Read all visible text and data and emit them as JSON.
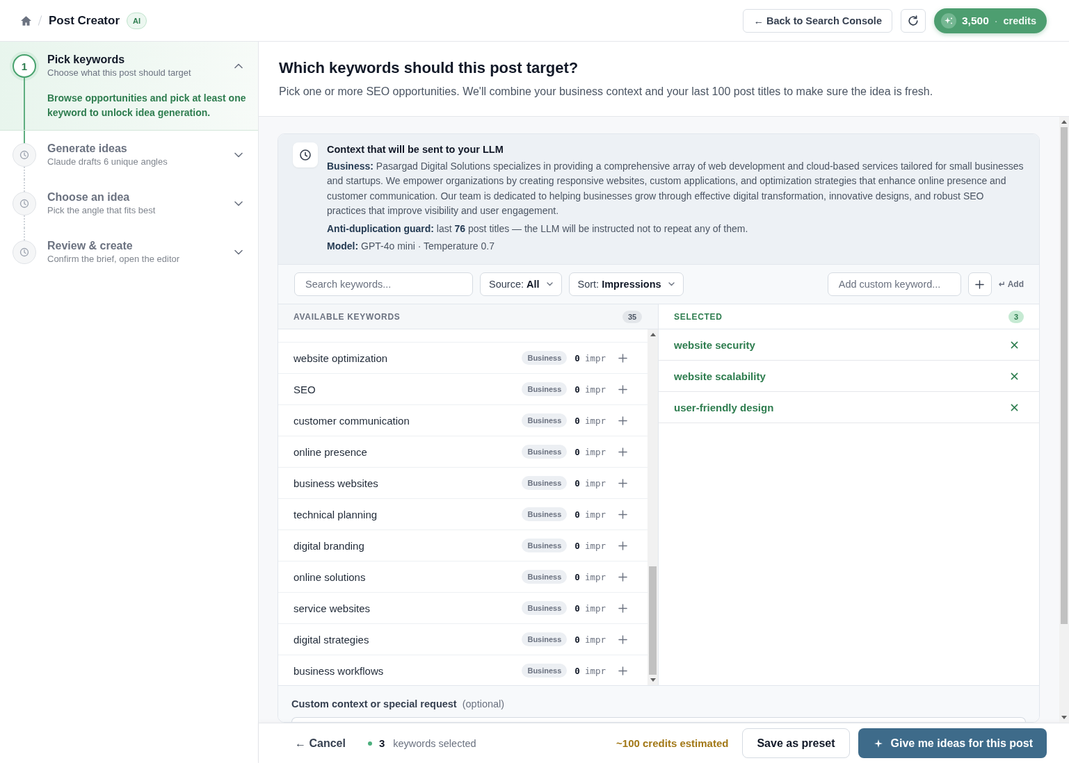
{
  "header": {
    "title": "Post Creator",
    "badge": "AI",
    "back_button": "← Back to Search Console",
    "credits": {
      "amount": "3,500",
      "separator": "·",
      "unit": "credits"
    }
  },
  "steps": [
    {
      "number": "1",
      "title": "Pick keywords",
      "subtitle": "Choose what this post should target",
      "description": "Browse opportunities and pick at least one keyword to unlock idea generation.",
      "selected": true,
      "expanded": true
    },
    {
      "title": "Generate ideas",
      "subtitle": "Claude drafts 6 unique angles",
      "selected": false,
      "expanded": false
    },
    {
      "title": "Choose an idea",
      "subtitle": "Pick the angle that fits best",
      "selected": false,
      "expanded": false
    },
    {
      "title": "Review & create",
      "subtitle": "Confirm the brief, open the editor",
      "selected": false,
      "expanded": false
    }
  ],
  "page": {
    "title": "Which keywords should this post target?",
    "subtitle": "Pick one or more SEO opportunities. We'll combine your business context and your last 100 post titles to make sure the idea is fresh."
  },
  "context": {
    "title": "Context that will be sent to your LLM",
    "lines": [
      "**Business:** Pasargad Digital Solutions specializes in providing a comprehensive array of web development and cloud-based services tailored for small businesses and startups. We empower organizations by creating responsive websites, custom applications, and optimization strategies that enhance online presence and customer communication. Our team is dedicated to helping businesses grow through effective digital transformation, innovative designs, and robust SEO practices that improve visibility and user engagement.",
      "**Anti-duplication guard:** last **76** post titles — the LLM will be instructed not to repeat any of them.",
      "**Model:** GPT-4o mini · Temperature 0.7"
    ]
  },
  "toolbar": {
    "search": {
      "placeholder": "Search keywords..."
    },
    "filters": [
      "Source: **All**",
      "Sort: **Impressions**"
    ],
    "custom_keyword": {
      "placeholder": "Add custom keyword..."
    },
    "add_hint": "↵ Add"
  },
  "available": {
    "heading": "AVAILABLE KEYWORDS",
    "count": "35",
    "rows": [
      {
        "keyword": "website optimization",
        "source": "Business",
        "impressions": "0",
        "unit": "impr"
      },
      {
        "keyword": "SEO",
        "source": "Business",
        "impressions": "0",
        "unit": "impr"
      },
      {
        "keyword": "customer communication",
        "source": "Business",
        "impressions": "0",
        "unit": "impr"
      },
      {
        "keyword": "online presence",
        "source": "Business",
        "impressions": "0",
        "unit": "impr"
      },
      {
        "keyword": "business websites",
        "source": "Business",
        "impressions": "0",
        "unit": "impr"
      },
      {
        "keyword": "technical planning",
        "source": "Business",
        "impressions": "0",
        "unit": "impr"
      },
      {
        "keyword": "digital branding",
        "source": "Business",
        "impressions": "0",
        "unit": "impr"
      },
      {
        "keyword": "online solutions",
        "source": "Business",
        "impressions": "0",
        "unit": "impr"
      },
      {
        "keyword": "service websites",
        "source": "Business",
        "impressions": "0",
        "unit": "impr"
      },
      {
        "keyword": "digital strategies",
        "source": "Business",
        "impressions": "0",
        "unit": "impr"
      },
      {
        "keyword": "business workflows",
        "source": "Business",
        "impressions": "0",
        "unit": "impr"
      }
    ]
  },
  "selected": {
    "heading": "SELECTED",
    "count": "3",
    "items": [
      "website security",
      "website scalability",
      "user-friendly design"
    ]
  },
  "custom_context": {
    "label": "Custom context or special request",
    "hint": "(optional)"
  },
  "footer": {
    "cancel": "← Cancel",
    "count": "3",
    "count_label": "keywords selected",
    "estimate": "~100 credits estimated",
    "buttons": [
      {
        "label": "Save as preset",
        "kind": "secondary"
      },
      {
        "label": "Give me ideas for this post",
        "kind": "primary"
      }
    ]
  }
}
